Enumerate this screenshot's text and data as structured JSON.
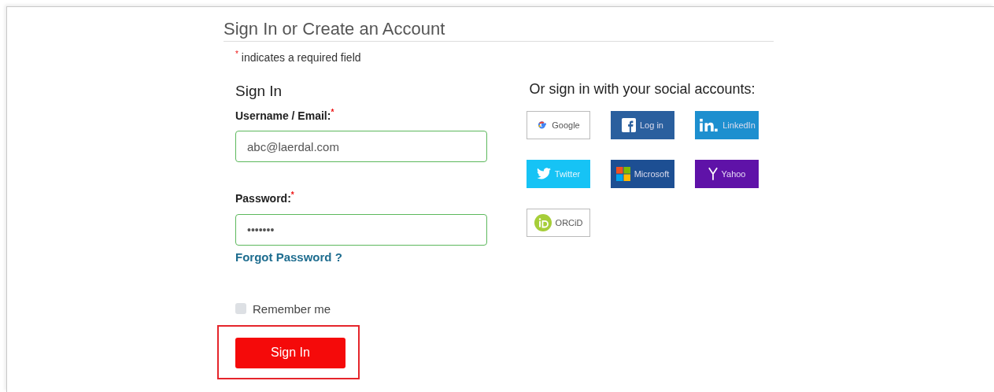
{
  "title": "Sign In or Create an Account",
  "required_note": {
    "required_mark": "*",
    "text": "indicates a required field"
  },
  "sign_in": {
    "heading": "Sign In",
    "username": {
      "label": "Username / Email:",
      "required_mark": "*",
      "value": "abc@laerdal.com"
    },
    "password": {
      "label": "Password:",
      "required_mark": "*",
      "value": "•••••••"
    },
    "forgot_link": "Forgot Password ?",
    "remember": {
      "label": "Remember me",
      "checked": false
    },
    "button": {
      "label": "Sign In",
      "highlighted": true
    }
  },
  "social": {
    "heading": "Or sign in with your social accounts:",
    "buttons": [
      {
        "kind": "google",
        "label": "Google"
      },
      {
        "kind": "facebook",
        "label": "Log in"
      },
      {
        "kind": "linkedin",
        "label": "LinkedIn"
      },
      {
        "kind": "twitter",
        "label": "Twitter"
      },
      {
        "kind": "microsoft",
        "label": "Microsoft"
      },
      {
        "kind": "yahoo",
        "label": "Yahoo"
      },
      {
        "kind": "orcid",
        "label": "ORCiD"
      }
    ]
  }
}
